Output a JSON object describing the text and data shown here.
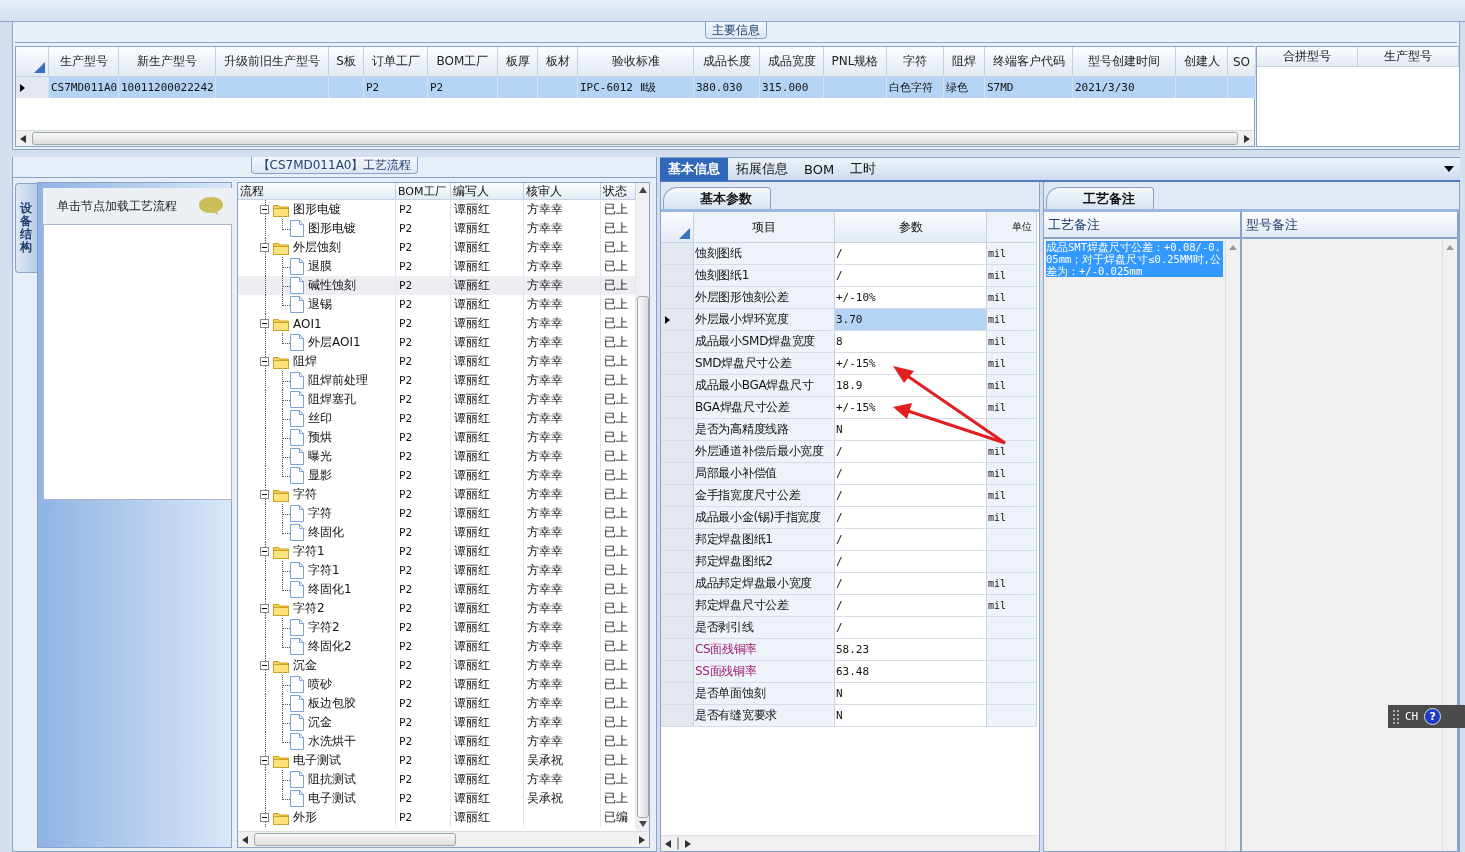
{
  "main_info": {
    "title": "主要信息",
    "columns": [
      "生产型号",
      "新生产型号",
      "升级前旧生产型号",
      "S板",
      "订单工厂",
      "BOM工厂",
      "板厚",
      "板材",
      "验收标准",
      "成品长度",
      "成品宽度",
      "PNL规格",
      "字符",
      "阻焊",
      "终端客户代码",
      "型号创建时间",
      "创建人",
      "SO"
    ],
    "rows": [
      {
        "selected": true,
        "cells": [
          "CS7MD011A0",
          "10011200022242",
          null,
          null,
          "P2",
          "P2",
          null,
          null,
          "IPC-6012 Ⅱ级",
          "380.030",
          "315.000",
          null,
          "白色字符",
          "绿色",
          "S7MD",
          "2021/3/30",
          null,
          null
        ]
      }
    ],
    "side_columns": [
      "合拼型号",
      "生产型号"
    ]
  },
  "process_panel": {
    "title": "【CS7MD011A0】工艺流程",
    "side_tab": "设备结构",
    "hint": "单击节点加载工艺流程",
    "columns": [
      "流程",
      "BOM工厂",
      "编写人",
      "核审人",
      "状态"
    ],
    "tree": [
      {
        "name": "图形电镀",
        "factory": "P2",
        "writer": "谭丽红",
        "reviewer": "方幸幸",
        "status": "已上",
        "selected": false,
        "expanded": true,
        "children": [
          {
            "name": "图形电镀",
            "factory": "P2",
            "writer": "谭丽红",
            "reviewer": "方幸幸",
            "status": "已上",
            "selected": false
          }
        ]
      },
      {
        "name": "外层蚀刻",
        "factory": "P2",
        "writer": "谭丽红",
        "reviewer": "方幸幸",
        "status": "已上",
        "selected": false,
        "expanded": true,
        "children": [
          {
            "name": "退膜",
            "factory": "P2",
            "writer": "谭丽红",
            "reviewer": "方幸幸",
            "status": "已上",
            "selected": false
          },
          {
            "name": "碱性蚀刻",
            "factory": "P2",
            "writer": "谭丽红",
            "reviewer": "方幸幸",
            "status": "已上",
            "selected": true
          },
          {
            "name": "退锡",
            "factory": "P2",
            "writer": "谭丽红",
            "reviewer": "方幸幸",
            "status": "已上",
            "selected": false
          }
        ]
      },
      {
        "name": "AOI1",
        "factory": "P2",
        "writer": "谭丽红",
        "reviewer": "方幸幸",
        "status": "已上",
        "selected": false,
        "expanded": true,
        "children": [
          {
            "name": "外层AOI1",
            "factory": "P2",
            "writer": "谭丽红",
            "reviewer": "方幸幸",
            "status": "已上",
            "selected": false
          }
        ]
      },
      {
        "name": "阻焊",
        "factory": "P2",
        "writer": "谭丽红",
        "reviewer": "方幸幸",
        "status": "已上",
        "selected": false,
        "expanded": true,
        "children": [
          {
            "name": "阻焊前处理",
            "factory": "P2",
            "writer": "谭丽红",
            "reviewer": "方幸幸",
            "status": "已上",
            "selected": false
          },
          {
            "name": "阻焊塞孔",
            "factory": "P2",
            "writer": "谭丽红",
            "reviewer": "方幸幸",
            "status": "已上",
            "selected": false
          },
          {
            "name": "丝印",
            "factory": "P2",
            "writer": "谭丽红",
            "reviewer": "方幸幸",
            "status": "已上",
            "selected": false
          },
          {
            "name": "预烘",
            "factory": "P2",
            "writer": "谭丽红",
            "reviewer": "方幸幸",
            "status": "已上",
            "selected": false
          },
          {
            "name": "曝光",
            "factory": "P2",
            "writer": "谭丽红",
            "reviewer": "方幸幸",
            "status": "已上",
            "selected": false
          },
          {
            "name": "显影",
            "factory": "P2",
            "writer": "谭丽红",
            "reviewer": "方幸幸",
            "status": "已上",
            "selected": false
          }
        ]
      },
      {
        "name": "字符",
        "factory": "P2",
        "writer": "谭丽红",
        "reviewer": "方幸幸",
        "status": "已上",
        "selected": false,
        "expanded": true,
        "children": [
          {
            "name": "字符",
            "factory": "P2",
            "writer": "谭丽红",
            "reviewer": "方幸幸",
            "status": "已上",
            "selected": false
          },
          {
            "name": "终固化",
            "factory": "P2",
            "writer": "谭丽红",
            "reviewer": "方幸幸",
            "status": "已上",
            "selected": false
          }
        ]
      },
      {
        "name": "字符1",
        "factory": "P2",
        "writer": "谭丽红",
        "reviewer": "方幸幸",
        "status": "已上",
        "selected": false,
        "expanded": true,
        "children": [
          {
            "name": "字符1",
            "factory": "P2",
            "writer": "谭丽红",
            "reviewer": "方幸幸",
            "status": "已上",
            "selected": false
          },
          {
            "name": "终固化1",
            "factory": "P2",
            "writer": "谭丽红",
            "reviewer": "方幸幸",
            "status": "已上",
            "selected": false
          }
        ]
      },
      {
        "name": "字符2",
        "factory": "P2",
        "writer": "谭丽红",
        "reviewer": "方幸幸",
        "status": "已上",
        "selected": false,
        "expanded": true,
        "children": [
          {
            "name": "字符2",
            "factory": "P2",
            "writer": "谭丽红",
            "reviewer": "方幸幸",
            "status": "已上",
            "selected": false
          },
          {
            "name": "终固化2",
            "factory": "P2",
            "writer": "谭丽红",
            "reviewer": "方幸幸",
            "status": "已上",
            "selected": false
          }
        ]
      },
      {
        "name": "沉金",
        "factory": "P2",
        "writer": "谭丽红",
        "reviewer": "方幸幸",
        "status": "已上",
        "selected": false,
        "expanded": true,
        "children": [
          {
            "name": "喷砂",
            "factory": "P2",
            "writer": "谭丽红",
            "reviewer": "方幸幸",
            "status": "已上",
            "selected": false
          },
          {
            "name": "板边包胶",
            "factory": "P2",
            "writer": "谭丽红",
            "reviewer": "方幸幸",
            "status": "已上",
            "selected": false
          },
          {
            "name": "沉金",
            "factory": "P2",
            "writer": "谭丽红",
            "reviewer": "方幸幸",
            "status": "已上",
            "selected": false
          },
          {
            "name": "水洗烘干",
            "factory": "P2",
            "writer": "谭丽红",
            "reviewer": "方幸幸",
            "status": "已上",
            "selected": false
          }
        ]
      },
      {
        "name": "电子测试",
        "factory": "P2",
        "writer": "谭丽红",
        "reviewer": "吴承祝",
        "status": "已上",
        "selected": false,
        "expanded": true,
        "children": [
          {
            "name": "阻抗测试",
            "factory": "P2",
            "writer": "谭丽红",
            "reviewer": "方幸幸",
            "status": "已上",
            "selected": false
          },
          {
            "name": "电子测试",
            "factory": "P2",
            "writer": "谭丽红",
            "reviewer": "吴承祝",
            "status": "已上",
            "selected": false
          }
        ]
      },
      {
        "name": "外形",
        "factory": "P2",
        "writer": "谭丽红",
        "status": "已编",
        "selected": false,
        "expanded": true
      }
    ]
  },
  "detail_tabs": [
    {
      "label": "基本信息",
      "selected": true
    },
    {
      "label": "拓展信息",
      "selected": false
    },
    {
      "label": "BOM",
      "selected": false
    },
    {
      "label": "工时",
      "selected": false
    }
  ],
  "params": {
    "tab": "基本参数",
    "columns": [
      "项目",
      "参数",
      "单位"
    ],
    "rows": [
      {
        "item": "蚀刻图纸",
        "value": "/",
        "unit": "mil",
        "current": false,
        "emphasis": false
      },
      {
        "item": "蚀刻图纸1",
        "value": "/",
        "unit": "mil",
        "current": false,
        "emphasis": false
      },
      {
        "item": "外层图形蚀刻公差",
        "value": "+/-10%",
        "unit": "mil",
        "current": false,
        "emphasis": false
      },
      {
        "item": "外层最小焊环宽度",
        "value": "3.70",
        "unit": "mil",
        "current": true,
        "emphasis": false
      },
      {
        "item": "成品最小SMD焊盘宽度",
        "value": "8",
        "unit": "mil",
        "current": false,
        "emphasis": false
      },
      {
        "item": "SMD焊盘尺寸公差",
        "value": "+/-15%",
        "unit": "mil",
        "current": false,
        "emphasis": false
      },
      {
        "item": "成品最小BGA焊盘尺寸",
        "value": "18.9",
        "unit": "mil",
        "current": false,
        "emphasis": false
      },
      {
        "item": "BGA焊盘尺寸公差",
        "value": "+/-15%",
        "unit": "mil",
        "current": false,
        "emphasis": false
      },
      {
        "item": "是否为高精度线路",
        "value": "N",
        "unit": "",
        "current": false,
        "emphasis": false
      },
      {
        "item": "外层通道补偿后最小宽度",
        "value": "/",
        "unit": "mil",
        "current": false,
        "emphasis": false
      },
      {
        "item": "局部最小补偿值",
        "value": "/",
        "unit": "mil",
        "current": false,
        "emphasis": false
      },
      {
        "item": "金手指宽度尺寸公差",
        "value": "/",
        "unit": "mil",
        "current": false,
        "emphasis": false
      },
      {
        "item": "成品最小金(锡)手指宽度",
        "value": "/",
        "unit": "mil",
        "current": false,
        "emphasis": false
      },
      {
        "item": "邦定焊盘图纸1",
        "value": "/",
        "unit": "",
        "current": false,
        "emphasis": false
      },
      {
        "item": "邦定焊盘图纸2",
        "value": "/",
        "unit": "",
        "current": false,
        "emphasis": false
      },
      {
        "item": "成品邦定焊盘最小宽度",
        "value": "/",
        "unit": "mil",
        "current": false,
        "emphasis": false
      },
      {
        "item": "邦定焊盘尺寸公差",
        "value": "/",
        "unit": "mil",
        "current": false,
        "emphasis": false
      },
      {
        "item": "是否剥引线",
        "value": "/",
        "unit": "",
        "current": false,
        "emphasis": false
      },
      {
        "item": "CS面残铜率",
        "value": "58.23",
        "unit": "",
        "current": false,
        "emphasis": true
      },
      {
        "item": "SS面残铜率",
        "value": "63.48",
        "unit": "",
        "current": false,
        "emphasis": true
      },
      {
        "item": "是否单面蚀刻",
        "value": "N",
        "unit": "",
        "current": false,
        "emphasis": false
      },
      {
        "item": "是否有缝宽要求",
        "value": "N",
        "unit": "",
        "current": false,
        "emphasis": false
      }
    ]
  },
  "notes": {
    "tab": "工艺备注",
    "columns": [
      "工艺备注",
      "型号备注"
    ],
    "process_note": "成品SMT焊盘尺寸公差：+0.08/-0.05mm；对于焊盘尺寸≤0.25MM时,公差为：+/-0.025mm",
    "note_selected": true
  },
  "language_bar": {
    "label": "CH",
    "help": "?"
  }
}
